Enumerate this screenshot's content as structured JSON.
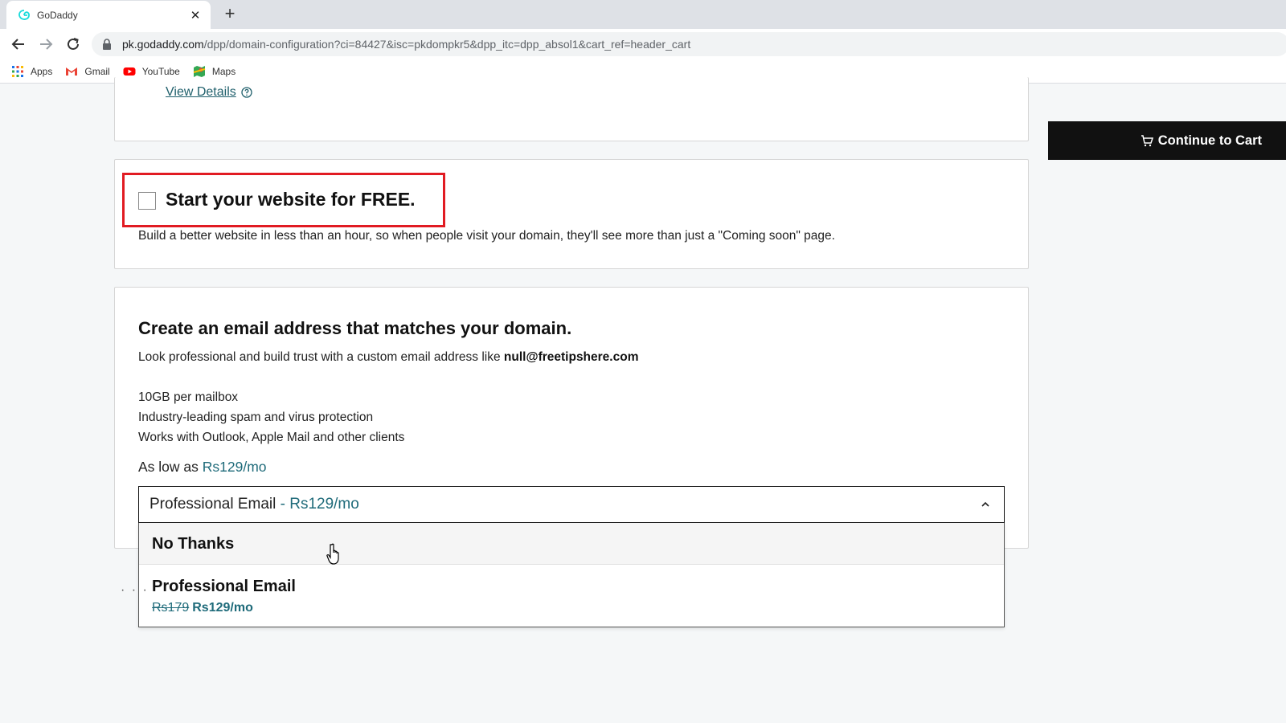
{
  "browser": {
    "tab_title": "GoDaddy",
    "close_glyph": "✕",
    "new_tab_glyph": "+",
    "url_host": "pk.godaddy.com",
    "url_path": "/dpp/domain-configuration?ci=84427&isc=pkdompkr5&dpp_itc=dpp_absol1&cart_ref=header_cart",
    "bookmarks": [
      {
        "label": "Apps",
        "icon": "apps-grid-icon"
      },
      {
        "label": "Gmail",
        "icon": "gmail-icon"
      },
      {
        "label": "YouTube",
        "icon": "youtube-icon"
      },
      {
        "label": "Maps",
        "icon": "maps-icon"
      }
    ]
  },
  "top_card": {
    "view_details": "View Details"
  },
  "website_card": {
    "title": "Start your website for FREE.",
    "description": "Build a better website in less than an hour, so when people visit your domain, they'll see more than just a \"Coming soon\" page.",
    "checked": false
  },
  "email_card": {
    "title": "Create an email address that matches your domain.",
    "description_prefix": "Look professional and build trust with a custom email address like ",
    "example_email": "null@freetipshere.com",
    "features": [
      "10GB per mailbox",
      "Industry-leading spam and virus protection",
      "Works with Outlook, Apple Mail and other clients"
    ],
    "price_prefix": "As low as ",
    "price": "Rs129/mo",
    "select_label": "Professional Email",
    "select_price": " - Rs129/mo",
    "options": {
      "no_thanks": "No Thanks",
      "pro_title": "Professional Email",
      "pro_old_price": "Rs179",
      "pro_new_price": "Rs129/mo"
    }
  },
  "cart_button": {
    "label": "Continue to Cart"
  },
  "misc": {
    "dots": "· · ·"
  },
  "colors": {
    "accent_teal": "#1f6b7a",
    "highlight_red": "#e11b22",
    "cart_button_bg": "#111111"
  }
}
